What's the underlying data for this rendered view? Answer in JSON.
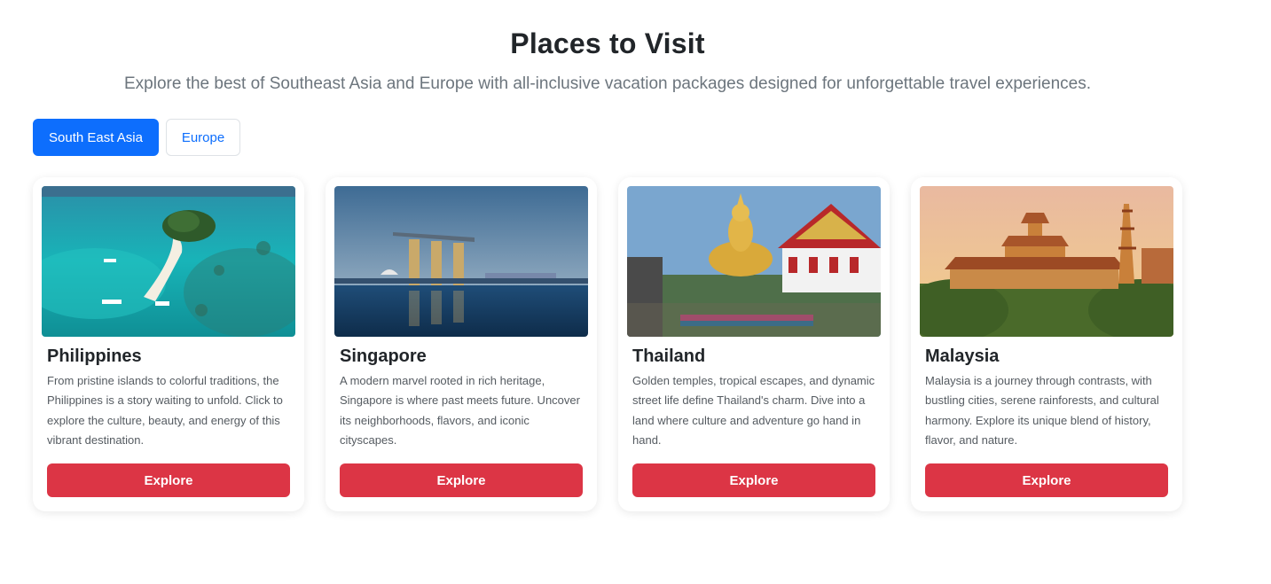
{
  "page": {
    "title": "Places to Visit",
    "subtitle": "Explore the best of Southeast Asia and Europe with all-inclusive vacation packages designed for unforgettable travel experiences."
  },
  "tabs": [
    {
      "label": "South East Asia",
      "active": true
    },
    {
      "label": "Europe",
      "active": false
    }
  ],
  "colors": {
    "primary": "#0d6efd",
    "danger": "#dc3545",
    "title": "#212529",
    "muted": "#6c757d"
  },
  "cards": [
    {
      "title": "Philippines",
      "description": "From pristine islands to colorful traditions, the Philippines is a story waiting to unfold. Click to explore the culture, beauty, and energy of this vibrant destination.",
      "button_label": "Explore",
      "image_icon": "tropical-island-photo"
    },
    {
      "title": "Singapore",
      "description": "A modern marvel rooted in rich heritage, Singapore is where past meets future. Uncover its neighborhoods, flavors, and iconic cityscapes.",
      "button_label": "Explore",
      "image_icon": "marina-bay-skyline-photo"
    },
    {
      "title": "Thailand",
      "description": "Golden temples, tropical escapes, and dynamic street life define Thailand's charm. Dive into a land where culture and adventure go hand in hand.",
      "button_label": "Explore",
      "image_icon": "golden-buddha-temple-photo"
    },
    {
      "title": "Malaysia",
      "description": "Malaysia is a journey through contrasts, with bustling cities, serene rainforests, and cultural harmony. Explore its unique blend of history, flavor, and nature.",
      "button_label": "Explore",
      "image_icon": "pagoda-temple-photo"
    }
  ]
}
